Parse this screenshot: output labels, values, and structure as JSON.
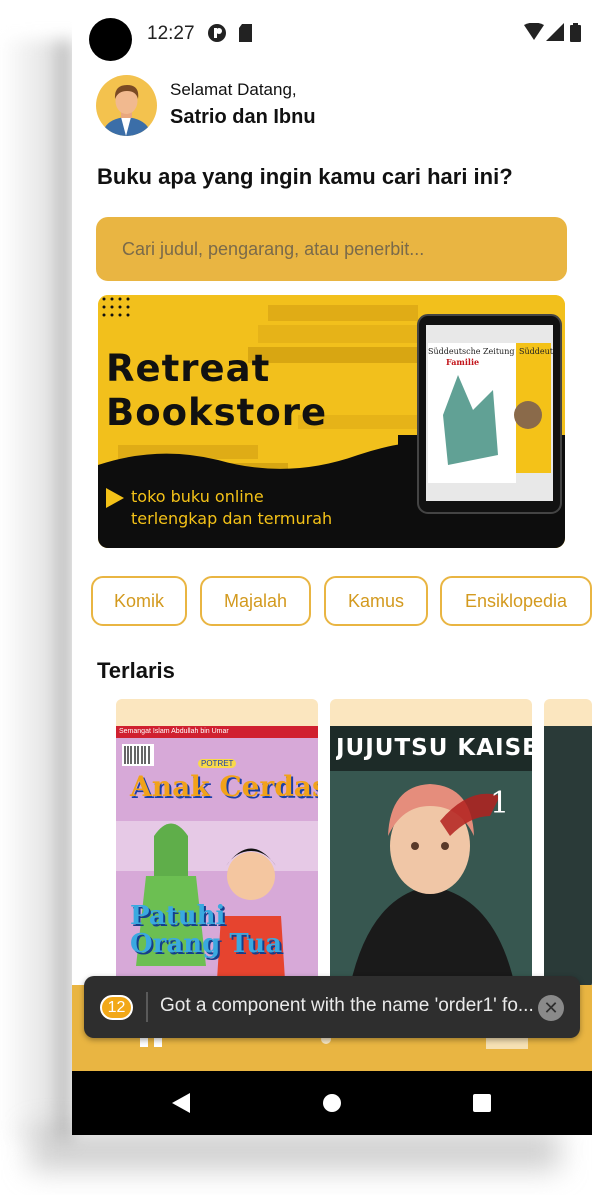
{
  "status_bar": {
    "time": "12:27"
  },
  "header": {
    "greeting": "Selamat Datang,",
    "username": "Satrio dan Ibnu",
    "question": "Buku apa yang ingin kamu cari hari ini?"
  },
  "search": {
    "placeholder": "Cari judul, pengarang, atau penerbit..."
  },
  "banner": {
    "title_line1": "Retreat",
    "title_line2": "Bookstore",
    "subtitle_line1": "toko buku online",
    "subtitle_line2": "terlengkap dan termurah",
    "magazine_front": "Süddeutsche Zeitung",
    "magazine_front_sub": "Familie",
    "magazine_back": "Süddeutsch"
  },
  "categories": [
    "Komik",
    "Majalah",
    "Kamus",
    "Ensiklopedia"
  ],
  "section": {
    "bestseller_title": "Terlaris"
  },
  "books": [
    {
      "top_strip": "Semangat Islam Abdullah bin Umar",
      "publisher_badge": "POTRET",
      "title": "Anak Cerdas",
      "cover_line1": "Patuhi",
      "cover_line2": "Orang Tua"
    },
    {
      "title": "JUJUTSU KAISEN",
      "volume": "1"
    }
  ],
  "toast": {
    "count": "12",
    "message": "Got a component with the name 'order1' fo..."
  },
  "colors": {
    "accent": "#e9b542",
    "banner_yellow": "#f4c218",
    "chip_text": "#d39a1f",
    "toast_bg": "#2e2e2e"
  }
}
